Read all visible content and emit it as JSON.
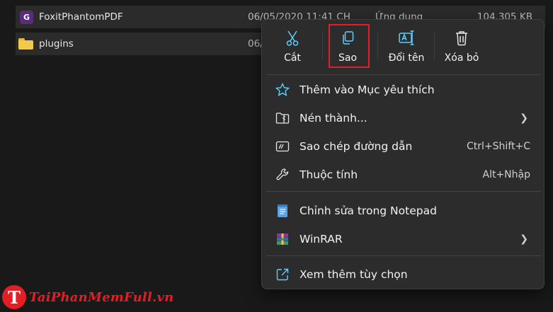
{
  "files": [
    {
      "name": "FoxitPhantomPDF",
      "date": "06/05/2020 11:41 CH",
      "type": "Ứng dụng",
      "size": "104.305 KB",
      "icon": "pdf-app-icon"
    },
    {
      "name": "plugins",
      "date": "06/",
      "icon": "folder-icon"
    }
  ],
  "context_menu": {
    "quick_actions": [
      {
        "label": "Cắt",
        "icon": "scissors-icon"
      },
      {
        "label": "Sao",
        "icon": "copy-icon"
      },
      {
        "label": "Đổi tên",
        "icon": "rename-icon"
      },
      {
        "label": "Xóa bỏ",
        "icon": "trash-icon"
      }
    ],
    "items": [
      {
        "label": "Thêm vào Mục yêu thích",
        "icon": "star-icon"
      },
      {
        "label": "Nén thành...",
        "icon": "zip-folder-icon",
        "submenu": true
      },
      {
        "label": "Sao chép đường dẫn",
        "shortcut": "Ctrl+Shift+C",
        "icon": "copy-path-icon"
      },
      {
        "label": "Thuộc tính",
        "shortcut": "Alt+Nhập",
        "icon": "wrench-icon"
      },
      {
        "label": "Chỉnh sửa trong Notepad",
        "icon": "notepad-icon"
      },
      {
        "label": "WinRAR",
        "icon": "winrar-icon",
        "submenu": true
      },
      {
        "label": "Xem thêm tùy chọn",
        "icon": "more-options-icon"
      }
    ]
  },
  "watermark": {
    "logo_letter": "T",
    "text": "TaiPhanMemFull.vn"
  },
  "colors": {
    "highlight_box": "#e31e24",
    "menu_bg": "#2c2c2c",
    "accent_blue": "#60cdff"
  }
}
